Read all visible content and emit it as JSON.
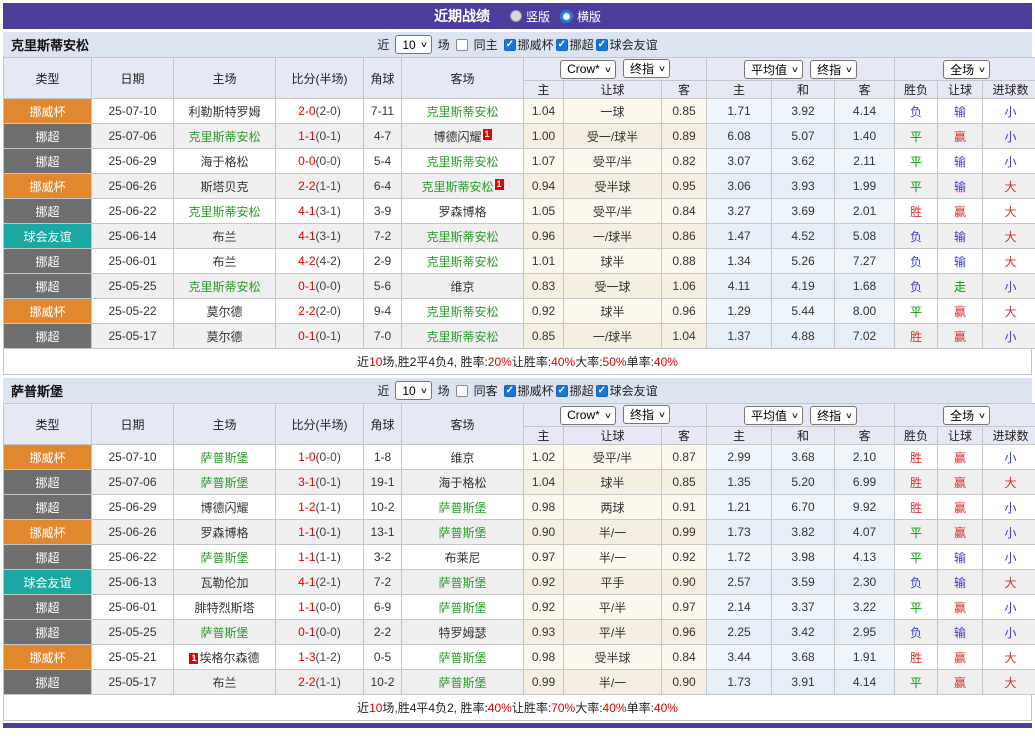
{
  "title_bar": {
    "title": "近期战绩",
    "radios": [
      {
        "label": "竖版",
        "selected": false
      },
      {
        "label": "横版",
        "selected": true
      }
    ]
  },
  "filter": {
    "near_label": "近",
    "count": "10",
    "games_label": "场",
    "leagues": [
      "挪威杯",
      "挪超",
      "球会友谊"
    ]
  },
  "columns": {
    "type": "类型",
    "date": "日期",
    "home": "主场",
    "score": "比分(半场)",
    "corner": "角球",
    "away": "客场",
    "ah_home": "主",
    "ah_line": "让球",
    "ah_away": "客",
    "eu_home": "主",
    "eu_draw": "和",
    "eu_away": "客",
    "res_wdl": "胜负",
    "res_ah": "让球",
    "res_goals": "进球数"
  },
  "dropdowns": {
    "ah_company": "Crow*",
    "ah_stage": "终指",
    "eu_company": "平均值",
    "eu_stage": "终指",
    "scope": "全场"
  },
  "colors": {
    "accent": "#4a3d9c",
    "league": {
      "挪威杯": "#e1882f",
      "挪超": "#6e6e6e",
      "球会友谊": "#1aa8a2"
    },
    "result": {
      "胜": "#d43030",
      "平": "#00a000",
      "负": "#3b3bcc",
      "赢": "#d43030",
      "输": "#3b3bcc",
      "走": "#00a000",
      "大": "#d43030",
      "小": "#3b3bcc"
    },
    "self_team": "#2d9b2d",
    "score": "#e00000"
  },
  "tables": [
    {
      "team": "克里斯蒂安松",
      "same_label": "同主",
      "rows": [
        {
          "type": "挪威杯",
          "date": "25-07-10",
          "home": "利勒斯特罗姆",
          "home_self": false,
          "score": "2-0",
          "half": "(2-0)",
          "corner": "7-11",
          "away": "克里斯蒂安松",
          "away_self": true,
          "ah": [
            "1.04",
            "一球",
            "0.85"
          ],
          "eu": [
            "1.71",
            "3.92",
            "4.14"
          ],
          "res": [
            "负",
            "输",
            "小"
          ]
        },
        {
          "type": "挪超",
          "date": "25-07-06",
          "home": "克里斯蒂安松",
          "home_self": true,
          "score": "1-1",
          "half": "(0-1)",
          "corner": "4-7",
          "away": "博德闪耀",
          "away_self": false,
          "away_badge": "1",
          "ah": [
            "1.00",
            "受一/球半",
            "0.89"
          ],
          "eu": [
            "6.08",
            "5.07",
            "1.40"
          ],
          "res": [
            "平",
            "赢",
            "小"
          ]
        },
        {
          "type": "挪超",
          "date": "25-06-29",
          "home": "海于格松",
          "home_self": false,
          "score": "0-0",
          "half": "(0-0)",
          "corner": "5-4",
          "away": "克里斯蒂安松",
          "away_self": true,
          "ah": [
            "1.07",
            "受平/半",
            "0.82"
          ],
          "eu": [
            "3.07",
            "3.62",
            "2.11"
          ],
          "res": [
            "平",
            "输",
            "小"
          ]
        },
        {
          "type": "挪威杯",
          "date": "25-06-26",
          "home": "斯塔贝克",
          "home_self": false,
          "score": "2-2",
          "half": "(1-1)",
          "corner": "6-4",
          "away": "克里斯蒂安松",
          "away_self": true,
          "away_badge": "1",
          "ah": [
            "0.94",
            "受半球",
            "0.95"
          ],
          "eu": [
            "3.06",
            "3.93",
            "1.99"
          ],
          "res": [
            "平",
            "输",
            "大"
          ]
        },
        {
          "type": "挪超",
          "date": "25-06-22",
          "home": "克里斯蒂安松",
          "home_self": true,
          "score": "4-1",
          "half": "(3-1)",
          "corner": "3-9",
          "away": "罗森博格",
          "away_self": false,
          "ah": [
            "1.05",
            "受平/半",
            "0.84"
          ],
          "eu": [
            "3.27",
            "3.69",
            "2.01"
          ],
          "res": [
            "胜",
            "赢",
            "大"
          ]
        },
        {
          "type": "球会友谊",
          "date": "25-06-14",
          "home": "布兰",
          "home_self": false,
          "score": "4-1",
          "half": "(3-1)",
          "corner": "7-2",
          "away": "克里斯蒂安松",
          "away_self": true,
          "ah": [
            "0.96",
            "一/球半",
            "0.86"
          ],
          "eu": [
            "1.47",
            "4.52",
            "5.08"
          ],
          "res": [
            "负",
            "输",
            "大"
          ]
        },
        {
          "type": "挪超",
          "date": "25-06-01",
          "home": "布兰",
          "home_self": false,
          "score": "4-2",
          "half": "(4-2)",
          "corner": "2-9",
          "away": "克里斯蒂安松",
          "away_self": true,
          "ah": [
            "1.01",
            "球半",
            "0.88"
          ],
          "eu": [
            "1.34",
            "5.26",
            "7.27"
          ],
          "res": [
            "负",
            "输",
            "大"
          ]
        },
        {
          "type": "挪超",
          "date": "25-05-25",
          "home": "克里斯蒂安松",
          "home_self": true,
          "score": "0-1",
          "half": "(0-0)",
          "corner": "5-6",
          "away": "维京",
          "away_self": false,
          "ah": [
            "0.83",
            "受一球",
            "1.06"
          ],
          "eu": [
            "4.11",
            "4.19",
            "1.68"
          ],
          "res": [
            "负",
            "走",
            "小"
          ]
        },
        {
          "type": "挪威杯",
          "date": "25-05-22",
          "home": "莫尔德",
          "home_self": false,
          "score": "2-2",
          "half": "(2-0)",
          "corner": "9-4",
          "away": "克里斯蒂安松",
          "away_self": true,
          "ah": [
            "0.92",
            "球半",
            "0.96"
          ],
          "eu": [
            "1.29",
            "5.44",
            "8.00"
          ],
          "res": [
            "平",
            "赢",
            "大"
          ]
        },
        {
          "type": "挪超",
          "date": "25-05-17",
          "home": "莫尔德",
          "home_self": false,
          "score": "0-1",
          "half": "(0-1)",
          "corner": "7-0",
          "away": "克里斯蒂安松",
          "away_self": true,
          "ah": [
            "0.85",
            "一/球半",
            "1.04"
          ],
          "eu": [
            "1.37",
            "4.88",
            "7.02"
          ],
          "res": [
            "胜",
            "赢",
            "小"
          ]
        }
      ],
      "summary": [
        {
          "text": "近",
          "red": false
        },
        {
          "text": "10",
          "red": true
        },
        {
          "text": "场,胜2平4负4, 胜率:",
          "red": false
        },
        {
          "text": "20%",
          "red": true
        },
        {
          "text": " 让胜率:",
          "red": false
        },
        {
          "text": "40%",
          "red": true
        },
        {
          "text": " 大率:",
          "red": false
        },
        {
          "text": "50%",
          "red": true
        },
        {
          "text": " 单率:",
          "red": false
        },
        {
          "text": "40%",
          "red": true
        }
      ]
    },
    {
      "team": "萨普斯堡",
      "same_label": "同客",
      "rows": [
        {
          "type": "挪威杯",
          "date": "25-07-10",
          "home": "萨普斯堡",
          "home_self": true,
          "score": "1-0",
          "half": "(0-0)",
          "corner": "1-8",
          "away": "维京",
          "away_self": false,
          "ah": [
            "1.02",
            "受平/半",
            "0.87"
          ],
          "eu": [
            "2.99",
            "3.68",
            "2.10"
          ],
          "res": [
            "胜",
            "赢",
            "小"
          ]
        },
        {
          "type": "挪超",
          "date": "25-07-06",
          "home": "萨普斯堡",
          "home_self": true,
          "score": "3-1",
          "half": "(0-1)",
          "corner": "19-1",
          "away": "海于格松",
          "away_self": false,
          "ah": [
            "1.04",
            "球半",
            "0.85"
          ],
          "eu": [
            "1.35",
            "5.20",
            "6.99"
          ],
          "res": [
            "胜",
            "赢",
            "大"
          ]
        },
        {
          "type": "挪超",
          "date": "25-06-29",
          "home": "博德闪耀",
          "home_self": false,
          "score": "1-2",
          "half": "(1-1)",
          "corner": "10-2",
          "away": "萨普斯堡",
          "away_self": true,
          "ah": [
            "0.98",
            "两球",
            "0.91"
          ],
          "eu": [
            "1.21",
            "6.70",
            "9.92"
          ],
          "res": [
            "胜",
            "赢",
            "小"
          ]
        },
        {
          "type": "挪威杯",
          "date": "25-06-26",
          "home": "罗森博格",
          "home_self": false,
          "score": "1-1",
          "half": "(0-1)",
          "corner": "13-1",
          "away": "萨普斯堡",
          "away_self": true,
          "ah": [
            "0.90",
            "半/一",
            "0.99"
          ],
          "eu": [
            "1.73",
            "3.82",
            "4.07"
          ],
          "res": [
            "平",
            "赢",
            "小"
          ]
        },
        {
          "type": "挪超",
          "date": "25-06-22",
          "home": "萨普斯堡",
          "home_self": true,
          "score": "1-1",
          "half": "(1-1)",
          "corner": "3-2",
          "away": "布莱尼",
          "away_self": false,
          "ah": [
            "0.97",
            "半/一",
            "0.92"
          ],
          "eu": [
            "1.72",
            "3.98",
            "4.13"
          ],
          "res": [
            "平",
            "输",
            "小"
          ]
        },
        {
          "type": "球会友谊",
          "date": "25-06-13",
          "home": "瓦勒伦加",
          "home_self": false,
          "score": "4-1",
          "half": "(2-1)",
          "corner": "7-2",
          "away": "萨普斯堡",
          "away_self": true,
          "ah": [
            "0.92",
            "平手",
            "0.90"
          ],
          "eu": [
            "2.57",
            "3.59",
            "2.30"
          ],
          "res": [
            "负",
            "输",
            "大"
          ]
        },
        {
          "type": "挪超",
          "date": "25-06-01",
          "home": "腓特烈斯塔",
          "home_self": false,
          "score": "1-1",
          "half": "(0-0)",
          "corner": "6-9",
          "away": "萨普斯堡",
          "away_self": true,
          "ah": [
            "0.92",
            "平/半",
            "0.97"
          ],
          "eu": [
            "2.14",
            "3.37",
            "3.22"
          ],
          "res": [
            "平",
            "赢",
            "小"
          ]
        },
        {
          "type": "挪超",
          "date": "25-05-25",
          "home": "萨普斯堡",
          "home_self": true,
          "score": "0-1",
          "half": "(0-0)",
          "corner": "2-2",
          "away": "特罗姆瑟",
          "away_self": false,
          "ah": [
            "0.93",
            "平/半",
            "0.96"
          ],
          "eu": [
            "2.25",
            "3.42",
            "2.95"
          ],
          "res": [
            "负",
            "输",
            "小"
          ]
        },
        {
          "type": "挪威杯",
          "date": "25-05-21",
          "home": "埃格尔森德",
          "home_self": false,
          "home_badge": "1",
          "score": "1-3",
          "half": "(1-2)",
          "corner": "0-5",
          "away": "萨普斯堡",
          "away_self": true,
          "ah": [
            "0.98",
            "受半球",
            "0.84"
          ],
          "eu": [
            "3.44",
            "3.68",
            "1.91"
          ],
          "res": [
            "胜",
            "赢",
            "大"
          ]
        },
        {
          "type": "挪超",
          "date": "25-05-17",
          "home": "布兰",
          "home_self": false,
          "score": "2-2",
          "half": "(1-1)",
          "corner": "10-2",
          "away": "萨普斯堡",
          "away_self": true,
          "ah": [
            "0.99",
            "半/一",
            "0.90"
          ],
          "eu": [
            "1.73",
            "3.91",
            "4.14"
          ],
          "res": [
            "平",
            "赢",
            "大"
          ]
        }
      ],
      "summary": [
        {
          "text": "近",
          "red": false
        },
        {
          "text": "10",
          "red": true
        },
        {
          "text": "场,胜4平4负2, 胜率:",
          "red": false
        },
        {
          "text": "40%",
          "red": true
        },
        {
          "text": " 让胜率:",
          "red": false
        },
        {
          "text": "70%",
          "red": true
        },
        {
          "text": " 大率:",
          "red": false
        },
        {
          "text": "40%",
          "red": true
        },
        {
          "text": " 单率:",
          "red": false
        },
        {
          "text": "40%",
          "red": true
        }
      ]
    }
  ]
}
